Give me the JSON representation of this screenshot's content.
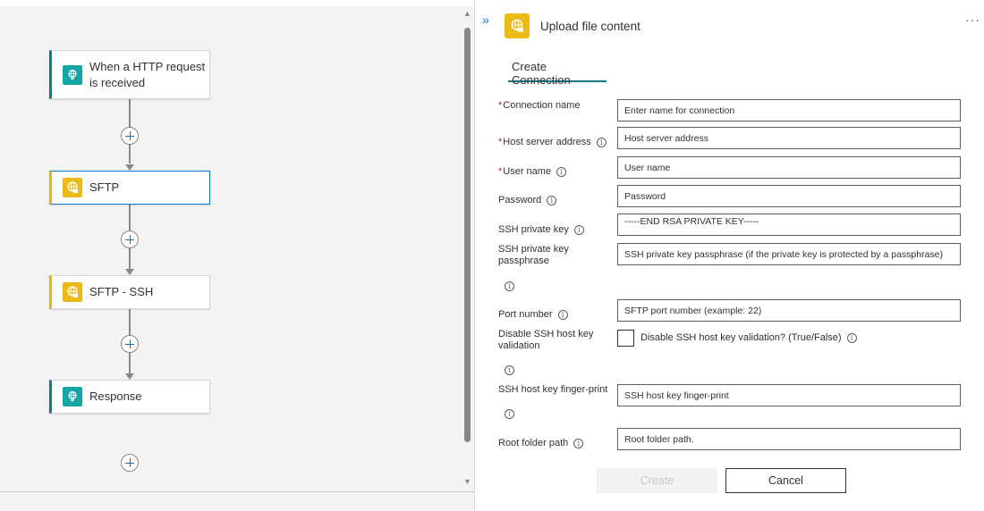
{
  "canvas": {
    "steps": [
      {
        "label": "When a HTTP request\nis received",
        "icon": "http-request-icon"
      },
      {
        "label": "SFTP",
        "icon": "sftp-icon"
      },
      {
        "label": "SFTP - SSH",
        "icon": "sftp-ssh-icon"
      },
      {
        "label": "Response",
        "icon": "response-icon"
      }
    ]
  },
  "panel": {
    "collapse_glyph": "»",
    "title": "Upload file content",
    "more_glyph": "···",
    "tab": "Create Connection",
    "fields": {
      "connection_name": {
        "label": "Connection name",
        "required": "*",
        "placeholder": "Enter name for connection"
      },
      "host": {
        "label": "Host server address",
        "required": "*",
        "placeholder": "Host server address"
      },
      "user": {
        "label": "User name",
        "required": "*",
        "placeholder": "User name"
      },
      "password": {
        "label": "Password",
        "placeholder": "Password"
      },
      "ssh_key": {
        "label": "SSH private key",
        "value": "-----END RSA PRIVATE KEY-----"
      },
      "passphrase": {
        "label": "SSH private key passphrase",
        "placeholder": "SSH private key passphrase (if the private key is protected by a passphrase)"
      },
      "port": {
        "label": "Port number",
        "placeholder": "SFTP port number (example: 22)"
      },
      "disable_validation": {
        "label": "Disable SSH host key validation",
        "checkbox_label": "Disable SSH host key validation? (True/False)"
      },
      "fingerprint": {
        "label": "SSH host key finger-print",
        "placeholder": "SSH host key finger-print"
      },
      "root_folder": {
        "label": "Root folder path",
        "placeholder": "Root folder path."
      }
    },
    "info_glyph": "i",
    "buttons": {
      "create": "Create",
      "cancel": "Cancel"
    }
  },
  "colors": {
    "accent": "#0078d4",
    "teal": "#13a6a6",
    "yellow": "#ecba17",
    "required": "#a4262c"
  }
}
